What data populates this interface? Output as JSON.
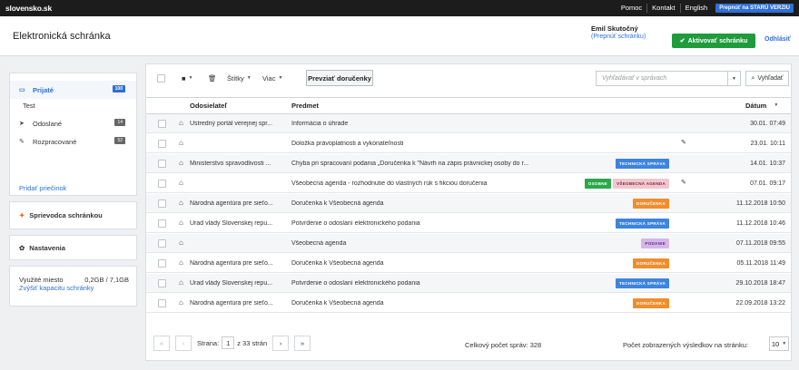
{
  "topbar": {
    "logo": "slovensko.sk",
    "links": [
      "Pomoc",
      "Kontakt",
      "English"
    ],
    "old_version": "Prepnúť na STARÚ VERZIU"
  },
  "header": {
    "title": "Elektronická schránka",
    "user_name": "Emil Skutočný",
    "switch_box": "(Prepnúť schránku)",
    "activate": "Aktivovať schránku",
    "logout": "Odhlásiť"
  },
  "sidebar": {
    "items": [
      {
        "label": "Prijaté",
        "count": "100",
        "icon": "inbox-icon"
      },
      {
        "label": "Odoslané",
        "count": "14",
        "icon": "send-icon"
      },
      {
        "label": "Rozpracované",
        "count": "52",
        "icon": "pencil-icon"
      }
    ],
    "sub_folder": "Test",
    "add_folder": "Pridať priečinok",
    "guide": "Sprievodca schránkou",
    "settings": "Nastavenia",
    "storage_label": "Využité miesto",
    "storage_value": "0,2GB / 7,1GB",
    "storage_add": "Zvýšiť kapacitu schránky"
  },
  "toolbar": {
    "labels": "Štítky",
    "more": "Viac",
    "download": "Prevziať doručenky",
    "search_placeholder": "Vyhľadávať v správach",
    "search_btn": "Vyhľadať"
  },
  "table": {
    "col_from": "Odosielateľ",
    "col_subject": "Predmet",
    "col_date": "Dátum",
    "rows": [
      {
        "from": "Ústredný portál verejnej spr...",
        "subject": "Informácia o úhrade",
        "tags": [],
        "att": false,
        "date": "30.01. 07:49"
      },
      {
        "from": "",
        "subject": "Doložka právoplatnosti a vykonateľnosti",
        "tags": [],
        "att": true,
        "date": "23.01. 10:11"
      },
      {
        "from": "Ministerstvo spravodlivosti ...",
        "subject": "Chyba pri spracovaní podania „Doručenka k \"Návrh na zápis právnickej osoby do r...",
        "tags": [
          {
            "t": "TECHNICKÁ SPRÁVA",
            "c": "#3d84de"
          }
        ],
        "att": false,
        "date": "14.01. 10:37"
      },
      {
        "from": "",
        "subject": "Všeobecná agenda - rozhodnutie do vlastných rúk s fikciou doručenia",
        "tags": [
          {
            "t": "OSOBNE",
            "c": "#2aa84a"
          },
          {
            "t": "VŠEOBECNÁ AGENDA",
            "c": "#f2c6cf",
            "fg": "#7a2838"
          }
        ],
        "att": true,
        "date": "07.01. 09:17"
      },
      {
        "from": "Národná agentúra pre sieťo...",
        "subject": "Doručenka k Všeobecná agenda",
        "tags": [
          {
            "t": "DORUČENKA",
            "c": "#f08d2c"
          }
        ],
        "att": false,
        "date": "11.12.2018 10:50"
      },
      {
        "from": "Úrad vlády Slovenskej repu...",
        "subject": "Potvrdenie o odoslaní elektronického podania",
        "tags": [
          {
            "t": "TECHNICKÁ SPRÁVA",
            "c": "#3d84de"
          }
        ],
        "att": false,
        "date": "11.12.2018 10:46"
      },
      {
        "from": "",
        "subject": "Všeobecná agenda",
        "tags": [
          {
            "t": "PODANIE",
            "c": "#d4b7ea",
            "fg": "#5a2f7a"
          }
        ],
        "att": false,
        "date": "07.11.2018 09:55"
      },
      {
        "from": "Národná agentúra pre sieťo...",
        "subject": "Doručenka k Všeobecná agenda",
        "tags": [
          {
            "t": "DORUČENKA",
            "c": "#f08d2c"
          }
        ],
        "att": false,
        "date": "05.11.2018 11:49"
      },
      {
        "from": "Úrad vlády Slovenskej repu...",
        "subject": "Potvrdenie o odoslaní elektronického podania",
        "tags": [
          {
            "t": "TECHNICKÁ SPRÁVA",
            "c": "#3d84de"
          }
        ],
        "att": false,
        "date": "29.10.2018 18:47"
      },
      {
        "from": "Národná agentúra pre sieťo...",
        "subject": "Doručenka k Všeobecná agenda",
        "tags": [
          {
            "t": "DORUČENKA",
            "c": "#f08d2c"
          }
        ],
        "att": false,
        "date": "22.09.2018 13:22"
      }
    ]
  },
  "pager": {
    "page_label": "Strana:",
    "page": "1",
    "of": "z 33 strán",
    "total": "Celkový počet správ: 328",
    "per_page_label": "Počet zobrazených výsledkov na stránku:",
    "per_page": "10"
  }
}
